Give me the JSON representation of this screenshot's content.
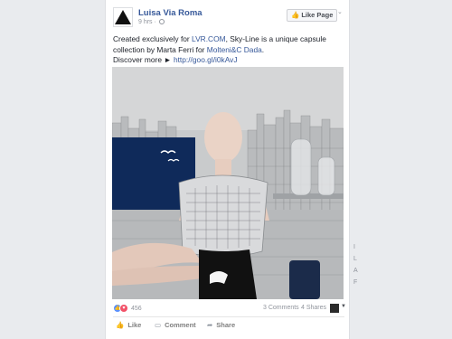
{
  "post": {
    "page_name": "Luisa Via Roma",
    "timestamp": "9 hrs",
    "separator": "·",
    "like_page_label": "Like Page",
    "text": {
      "part1": "Created exclusively for ",
      "link1": "LVR.COM",
      "part2": ", Sky-Line is a unique capsule collection by Marta Ferri for ",
      "link2": "Molteni&C Dada",
      "part3": ".",
      "part4": "Discover more ► ",
      "link3": "http://goo.gl/i0kAvJ"
    },
    "stats": {
      "reaction_count": "456",
      "comments": "3 Comments",
      "shares": "4 Shares"
    },
    "actions": {
      "like": "Like",
      "comment": "Comment",
      "share": "Share"
    }
  },
  "side_letters": [
    "I",
    "L",
    "A",
    "F"
  ],
  "icons": {
    "logo": "triangle-logo-icon",
    "privacy": "globe-icon",
    "menu": "chevron-down-icon",
    "like_page": "thumbs-up-icon",
    "like_reaction": "like-reaction-icon",
    "love_reaction": "love-reaction-icon",
    "like_action": "thumbs-up-icon",
    "comment_action": "comment-icon",
    "share_action": "share-icon"
  },
  "colors": {
    "link": "#365899",
    "like_reaction": "#5890ff",
    "love_reaction": "#f25268",
    "background": "#e9ebee"
  }
}
